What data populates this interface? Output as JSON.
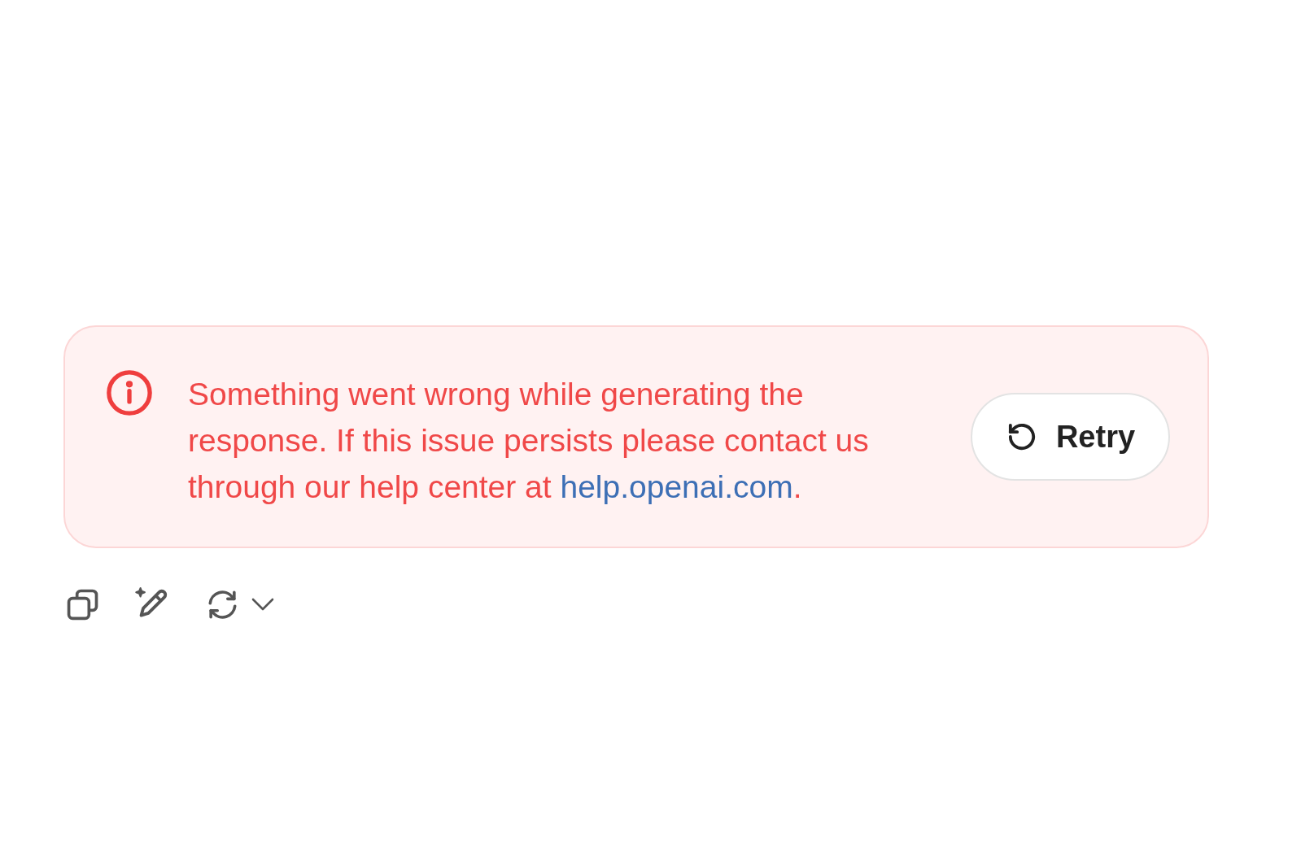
{
  "alert": {
    "message": "Something went wrong while generating the response. If this issue persists please contact us through our help center at ",
    "link": "help.openai.com",
    "message_end": ".",
    "retry_button": {
      "label": "Retry"
    }
  }
}
